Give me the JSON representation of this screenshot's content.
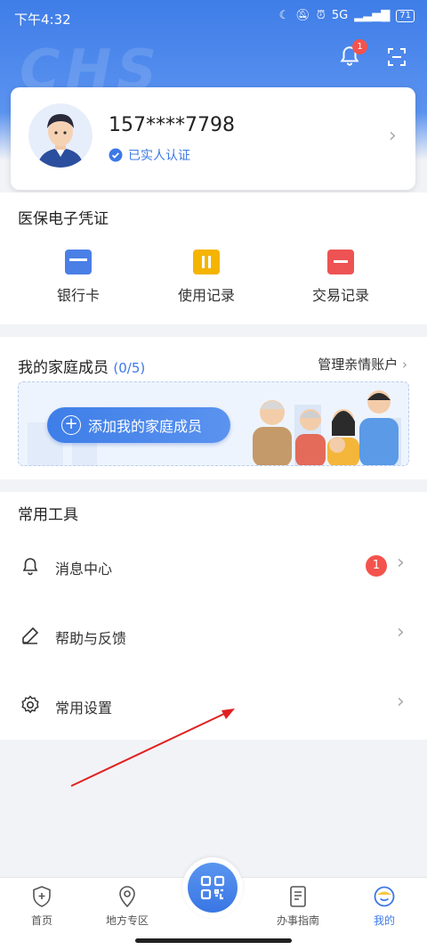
{
  "status_bar": {
    "time": "下午4:32",
    "network": "5G",
    "battery": "71"
  },
  "header": {
    "watermark": "CHS",
    "notification_count": "1"
  },
  "profile": {
    "phone": "157****7798",
    "verified_label": "已实人认证"
  },
  "voucher": {
    "title": "医保电子凭证",
    "items": [
      {
        "label": "银行卡",
        "icon": "bank-card-icon",
        "color": "#4a7fe6"
      },
      {
        "label": "使用记录",
        "icon": "usage-record-icon",
        "color": "#f5b400"
      },
      {
        "label": "交易记录",
        "icon": "transaction-record-icon",
        "color": "#ee5353"
      }
    ]
  },
  "family": {
    "title": "我的家庭成员",
    "count": "(0/5)",
    "manage_label": "管理亲情账户",
    "add_label": "添加我的家庭成员"
  },
  "tools": {
    "title": "常用工具",
    "items": [
      {
        "label": "消息中心",
        "icon": "bell-icon",
        "badge": "1"
      },
      {
        "label": "帮助与反馈",
        "icon": "pen-icon"
      },
      {
        "label": "常用设置",
        "icon": "gear-icon"
      }
    ]
  },
  "nav": {
    "items": [
      {
        "label": "首页",
        "icon": "shield-home-icon"
      },
      {
        "label": "地方专区",
        "icon": "location-pin-icon"
      },
      {
        "label": "",
        "icon": "qr-code-icon"
      },
      {
        "label": "办事指南",
        "icon": "document-icon"
      },
      {
        "label": "我的",
        "icon": "smile-face-icon",
        "active": true
      }
    ]
  },
  "colors": {
    "brand_blue": "#3c78e6",
    "badge_red": "#f4534d",
    "annotation_arrow": "#e02020"
  }
}
